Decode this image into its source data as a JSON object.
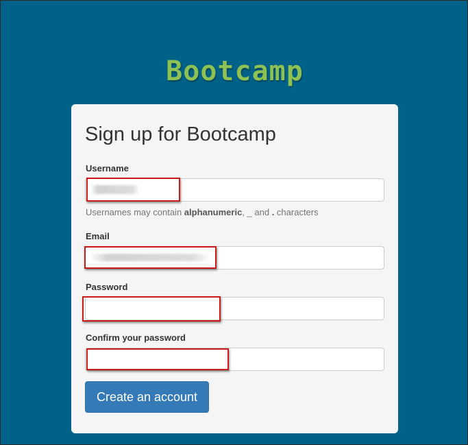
{
  "brand": {
    "logo_text": "Bootcamp",
    "color": "#8dc153"
  },
  "colors": {
    "background": "#006288",
    "card": "#f5f5f5",
    "primary": "#337ab7",
    "highlight_box": "#cc1a1a"
  },
  "form": {
    "title": "Sign up for Bootcamp",
    "username": {
      "label": "Username",
      "value": "",
      "help_prefix": "Usernames may contain ",
      "help_bold_1": "alphanumeric",
      "help_mid": ", _ and ",
      "help_bold_2": ".",
      "help_suffix": " characters"
    },
    "email": {
      "label": "Email",
      "value": ""
    },
    "password": {
      "label": "Password",
      "value": ""
    },
    "confirm_password": {
      "label": "Confirm your password",
      "value": ""
    },
    "submit_label": "Create an account"
  }
}
